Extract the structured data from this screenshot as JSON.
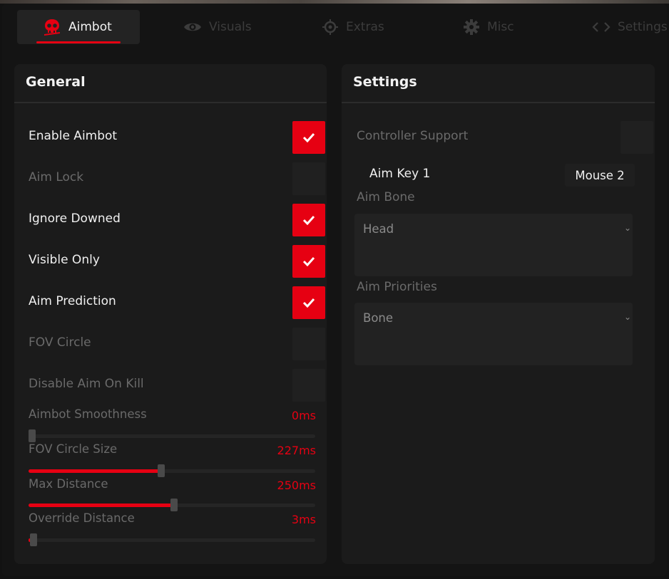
{
  "tabs": [
    {
      "label": "Aimbot",
      "icon": "skull-icon",
      "active": true
    },
    {
      "label": "Visuals",
      "icon": "eye-icon",
      "active": false
    },
    {
      "label": "Extras",
      "icon": "crosshair-icon",
      "active": false
    },
    {
      "label": "Misc",
      "icon": "gear-icon",
      "active": false
    },
    {
      "label": "Settings",
      "icon": "code-icon",
      "active": false
    }
  ],
  "general": {
    "title": "General",
    "toggles": [
      {
        "label": "Enable Aimbot",
        "checked": true
      },
      {
        "label": "Aim Lock",
        "checked": false
      },
      {
        "label": "Ignore Downed",
        "checked": true
      },
      {
        "label": "Visible Only",
        "checked": true
      },
      {
        "label": "Aim Prediction",
        "checked": true
      },
      {
        "label": "FOV Circle",
        "checked": false
      },
      {
        "label": "Disable Aim On Kill",
        "checked": false
      }
    ],
    "sliders": [
      {
        "label": "Aimbot Smoothness",
        "value": "0ms",
        "fraction": 0.0
      },
      {
        "label": "FOV Circle Size",
        "value": "227ms",
        "fraction": 0.455
      },
      {
        "label": "Max Distance",
        "value": "250ms",
        "fraction": 0.5
      },
      {
        "label": "Override Distance",
        "value": "3ms",
        "fraction": 0.01
      }
    ]
  },
  "settings": {
    "title": "Settings",
    "controller_support": {
      "label": "Controller Support",
      "checked": false
    },
    "aim_key": {
      "label": "Aim Key 1",
      "value": "Mouse 2"
    },
    "aim_bone": {
      "label": "Aim Bone",
      "value": "Head"
    },
    "aim_priorities": {
      "label": "Aim Priorities",
      "value": "Bone"
    }
  },
  "colors": {
    "accent": "#e60012",
    "panel": "#1b1b1b",
    "background": "#141414"
  }
}
